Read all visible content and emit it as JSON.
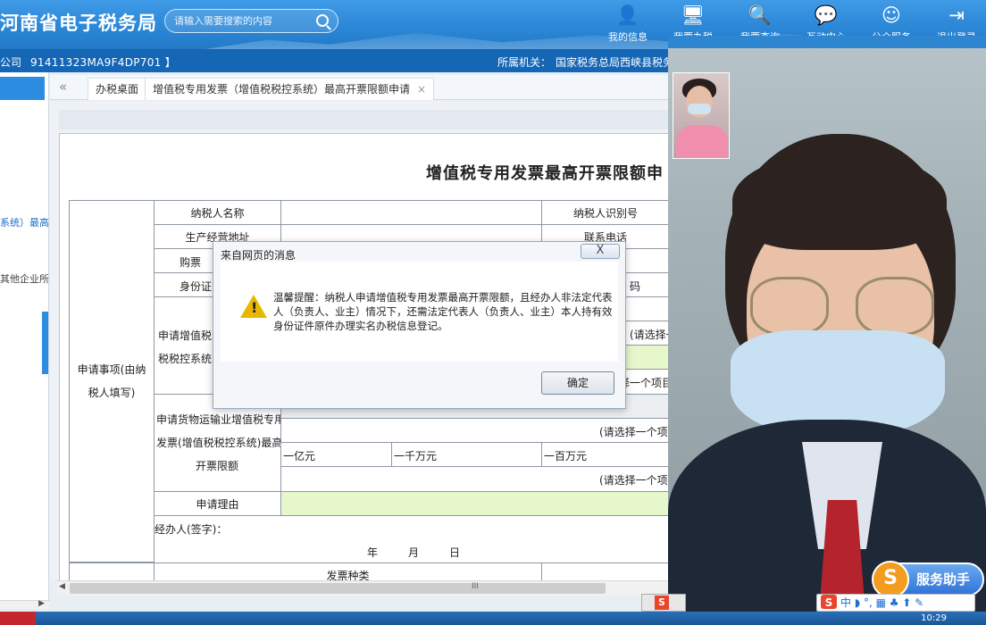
{
  "header": {
    "site_title": "河南省电子税务局",
    "search_placeholder": "请输入需要搜索的内容",
    "nav": [
      {
        "label": "我的信息",
        "icon": "user-icon"
      },
      {
        "label": "我要办税",
        "icon": "monitor-icon"
      },
      {
        "label": "我要查询",
        "icon": "query-icon"
      },
      {
        "label": "互动中心",
        "icon": "chat-icon"
      },
      {
        "label": "公众服务",
        "icon": "service-icon"
      },
      {
        "label": "退出登录",
        "icon": "logout-icon"
      }
    ]
  },
  "infobar": {
    "company_suffix": "公司",
    "tax_id": "91411323MA9F4DP701 】",
    "org_label": "所属机关：",
    "org_name": "国家税务总局西峡县税务"
  },
  "sidebar": {
    "links": [
      "系统）最高",
      "其他企业所"
    ]
  },
  "tabs": [
    {
      "label": "办税桌面"
    },
    {
      "label": "增值税专用发票（增值税税控系统）最高开票限额申请",
      "close": "×"
    }
  ],
  "form": {
    "title": "增值税专用发票最高开票限额申",
    "section_label": "申请事项(由纳税人填写)",
    "rows": {
      "taxpayer_name": "纳税人名称",
      "taxpayer_id": "纳税人识别号",
      "address": "生产经营地址",
      "phone": "联系电话",
      "buyer_prefix": "购票",
      "id_prefix": "身份证",
      "id_suffix": "码",
      "vat_apply_1": "申请增值税",
      "vat_apply_2": "税税控系统)",
      "select_hint": "(请选择一个项目",
      "select_hint_2": "择一个项目",
      "transport_l1": "申请货物运输业增值税专用",
      "transport_l2": "发票(增值税税控系统)最高",
      "transport_l3": "开票限额",
      "unit_100m": "一亿元",
      "unit_10m": "一千万元",
      "unit_1m": "一百万元",
      "reason": "申请理由",
      "agent_sign": "经办人(签字)：",
      "year": "年",
      "month": "月",
      "day": "日",
      "invoice_type": "发票种类"
    }
  },
  "dialog": {
    "title": "来自网页的消息",
    "close": "X",
    "message": "温馨提醒：纳税人申请增值税专用发票最高开票限额，且经办人非法定代表人（负责人、业主）情况下，还需法定代表人（负责人、业主）本人持有效身份证件原件办理实名办税信息登记。",
    "ok": "确定"
  },
  "scrollbar": {
    "grip": "III"
  },
  "video": {
    "assistant_label": "服务助手",
    "ime_text": "中 ◗ °, ▦ ♣ ⬆ ✎",
    "tray_letter": "S",
    "clock": "10:29"
  }
}
